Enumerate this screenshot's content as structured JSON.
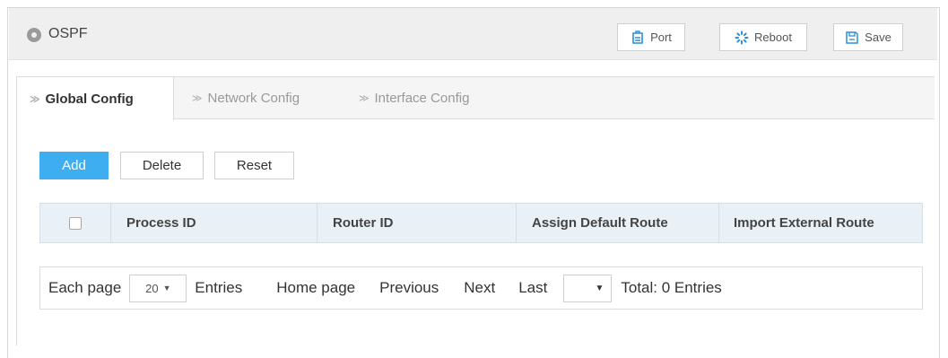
{
  "header": {
    "title": "OSPF",
    "icon": "location-pin-icon",
    "buttons": [
      {
        "label": "Port",
        "icon": "port-icon"
      },
      {
        "label": "Reboot",
        "icon": "reboot-spinner-icon"
      },
      {
        "label": "Save",
        "icon": "save-floppy-icon"
      }
    ]
  },
  "tabs": [
    {
      "label": "Global Config",
      "active": true
    },
    {
      "label": "Network Config",
      "active": false
    },
    {
      "label": "Interface Config",
      "active": false
    }
  ],
  "actions": {
    "add_label": "Add",
    "delete_label": "Delete",
    "reset_label": "Reset"
  },
  "table": {
    "columns": [
      "Process ID",
      "Router ID",
      "Assign Default Route",
      "Import External Route"
    ],
    "rows": []
  },
  "pagination": {
    "each_page_label": "Each page",
    "page_size": "20",
    "entries_label": "Entries",
    "home_label": "Home page",
    "previous_label": "Previous",
    "next_label": "Next",
    "last_label": "Last",
    "page_jump_value": "",
    "total_label": "Total: 0 Entries"
  },
  "colors": {
    "accent": "#3eaef0",
    "header_bg": "#efefef",
    "table_header_bg": "#e9f1f7"
  }
}
